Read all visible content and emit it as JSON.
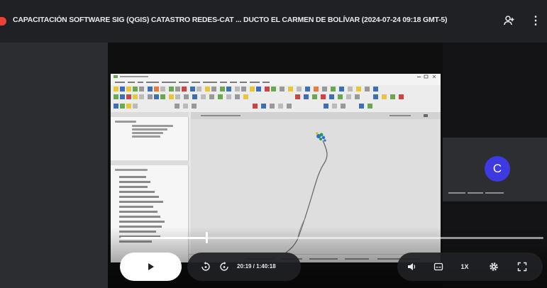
{
  "header": {
    "title": "CAPACITACIÓN SOFTWARE SIG (QGIS) CATASTRO REDES-CAT ... DUCTO EL CARMEN DE BOLÍVAR (2024-07-24 09:18 GMT-5)",
    "share_icon": "person-add-icon",
    "more_icon": "more-vert-icon"
  },
  "participant": {
    "initial": "C",
    "avatar_color": "#3c3ae0"
  },
  "player": {
    "current_time": "20:19",
    "separator": " / ",
    "duration": "1:40:18",
    "time_display": "20:19 / 1:40:18",
    "progress_fraction": 0.2025,
    "speed_label": "1X",
    "icons": {
      "play": "play-icon",
      "rewind": "rewind-10-icon",
      "forward": "forward-10-icon",
      "volume": "volume-icon",
      "captions": "captions-icon",
      "settings": "settings-gear-icon",
      "fullscreen": "fullscreen-icon"
    }
  },
  "colors": {
    "accent_red": "#ea4335",
    "background": "#202124",
    "track": "#ffffff"
  }
}
